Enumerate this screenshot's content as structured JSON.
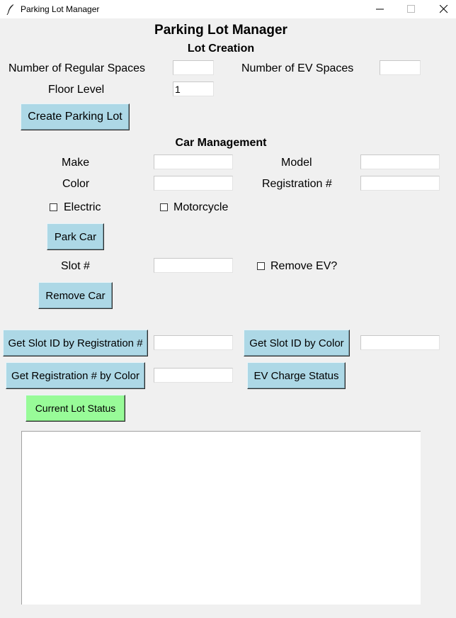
{
  "window": {
    "title": "Parking Lot Manager",
    "icon": "feather-icon"
  },
  "header": {
    "title": "Parking Lot Manager"
  },
  "lot_creation": {
    "heading": "Lot Creation",
    "regular_spaces_label": "Number of Regular Spaces",
    "regular_spaces_value": "",
    "ev_spaces_label": "Number of EV Spaces",
    "ev_spaces_value": "",
    "floor_level_label": "Floor Level",
    "floor_level_value": "1",
    "create_button": "Create Parking Lot"
  },
  "car_management": {
    "heading": "Car Management",
    "make_label": "Make",
    "make_value": "",
    "model_label": "Model",
    "model_value": "",
    "color_label": "Color",
    "color_value": "",
    "registration_label": "Registration #",
    "registration_value": "",
    "electric_label": "Electric",
    "electric_checked": false,
    "motorcycle_label": "Motorcycle",
    "motorcycle_checked": false,
    "park_button": "Park Car",
    "slot_label": "Slot #",
    "slot_value": "",
    "remove_ev_label": "Remove EV?",
    "remove_ev_checked": false,
    "remove_button": "Remove Car"
  },
  "queries": {
    "slot_by_registration_button": "Get Slot ID by Registration #",
    "slot_by_registration_value": "",
    "slot_by_color_button": "Get Slot ID by Color",
    "slot_by_color_value": "",
    "registration_by_color_button": "Get Registration # by Color",
    "registration_by_color_value": "",
    "ev_charge_status_button": "EV Charge Status",
    "current_lot_status_button": "Current Lot Status"
  },
  "output": {
    "text": ""
  },
  "colors": {
    "button_blue": "#add8e6",
    "button_green": "#98fb98",
    "background": "#f0f0f0"
  }
}
